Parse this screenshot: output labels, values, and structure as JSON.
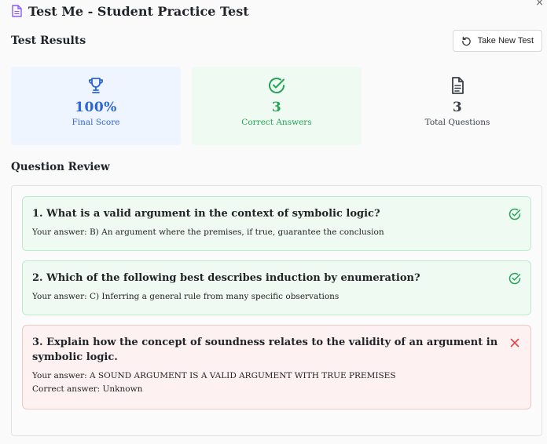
{
  "window": {
    "title": "Test Me - Student Practice Test",
    "close_glyph": "×"
  },
  "results": {
    "heading": "Test Results",
    "new_test_label": "Take New Test"
  },
  "stats": {
    "score": {
      "value": "100%",
      "label": "Final Score",
      "icon": "trophy-icon",
      "color": "#2f63d8"
    },
    "correct": {
      "value": "3",
      "label": "Correct Answers",
      "icon": "check-circle-icon",
      "color": "#23a356"
    },
    "total": {
      "value": "3",
      "label": "Total Questions",
      "icon": "document-icon",
      "color": "#3a3f45"
    }
  },
  "review": {
    "heading": "Question Review",
    "questions": [
      {
        "text": "1. What is a valid argument in the context of symbolic logic?",
        "answer": "Your answer: B) An argument where the premises, if true, guarantee the conclusion",
        "status": "correct"
      },
      {
        "text": "2. Which of the following best describes induction by enumeration?",
        "answer": "Your answer: C) Inferring a general rule from many specific observations",
        "status": "correct"
      },
      {
        "text": "3. Explain how the concept of soundness relates to the validity of an argument in symbolic logic.",
        "answer": "Your answer: A SOUND ARGUMENT IS A VALID ARGUMENT WITH TRUE PREMISES",
        "correct_answer": "Correct answer: Unknown",
        "status": "incorrect"
      }
    ]
  },
  "colors": {
    "correct": "#23a356",
    "incorrect": "#e04848",
    "accent": "#7a4fd1"
  }
}
